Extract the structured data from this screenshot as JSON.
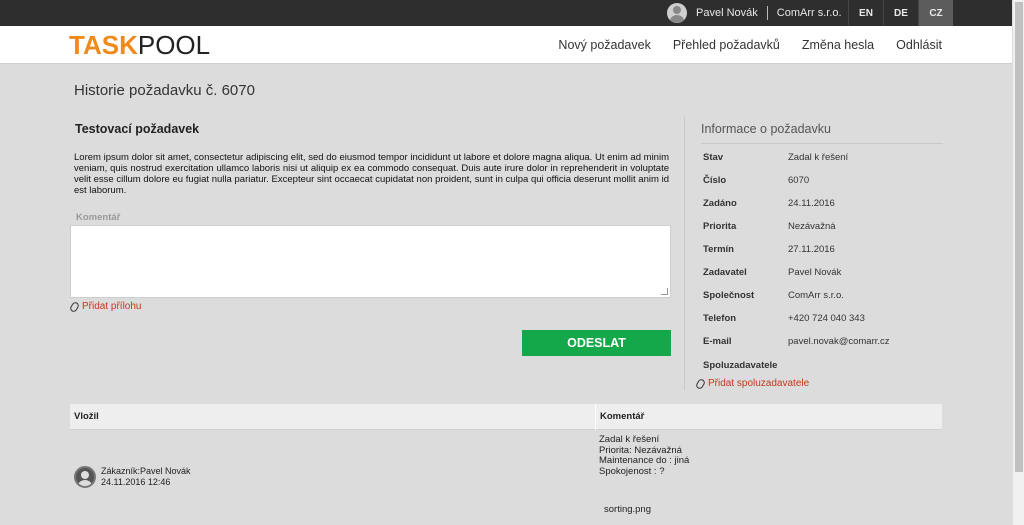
{
  "topbar": {
    "user_name": "Pavel Novák",
    "company": "ComArr s.r.o.",
    "languages": [
      {
        "code": "EN",
        "active": false
      },
      {
        "code": "DE",
        "active": false
      },
      {
        "code": "CZ",
        "active": true
      }
    ]
  },
  "header": {
    "logo_part1": "TASK",
    "logo_part2": "POOL",
    "nav": [
      "Nový požadavek",
      "Přehled požadavků",
      "Změna hesla",
      "Odhlásit"
    ]
  },
  "main": {
    "page_title": "Historie požadavku č. 6070",
    "request_title": "Testovací požadavek",
    "request_description": "Lorem ipsum dolor sit amet, consectetur adipiscing elit, sed do eiusmod tempor incididunt ut labore et dolore magna aliqua. Ut enim ad minim veniam, quis nostrud exercitation ullamco laboris nisi ut aliquip ex ea commodo consequat. Duis aute irure dolor in reprehenderit in voluptate velit esse cillum dolore eu fugiat nulla pariatur. Excepteur sint occaecat cupidatat non proident, sunt in culpa qui officia deserunt mollit anim id est laborum.",
    "comment_label": "Komentář",
    "comment_value": "",
    "attach_label": "Přidat přílohu",
    "send_label": "ODESLAT"
  },
  "info": {
    "title": "Informace o požadavku",
    "rows": [
      {
        "key": "Stav",
        "value": "Zadal k řešení"
      },
      {
        "key": "Číslo",
        "value": "6070"
      },
      {
        "key": "Zadáno",
        "value": "24.11.2016"
      },
      {
        "key": "Priorita",
        "value": "Nezávažná"
      },
      {
        "key": "Termín",
        "value": "27.11.2016"
      },
      {
        "key": "Zadavatel",
        "value": "Pavel Novák"
      },
      {
        "key": "Společnost",
        "value": "ComArr s.r.o."
      },
      {
        "key": "Telefon",
        "value": "+420 724 040 343"
      },
      {
        "key": "E-mail",
        "value": "pavel.novak@comarr.cz"
      },
      {
        "key": "Spoluzadavatele",
        "value": ""
      }
    ],
    "add_co_label": "Přidat spoluzadavatele"
  },
  "history": {
    "col_author": "Vložil",
    "col_comment": "Komentář",
    "entries": [
      {
        "author": "Zákazník:Pavel Novák",
        "timestamp": "24.11.2016 12:46",
        "comment_lines": [
          "Zadal k řešení",
          "Priorita: Nezávažná",
          "Maintenance do : jiná",
          "Spokojenost : ?"
        ],
        "attachment": "sorting.png"
      }
    ]
  }
}
